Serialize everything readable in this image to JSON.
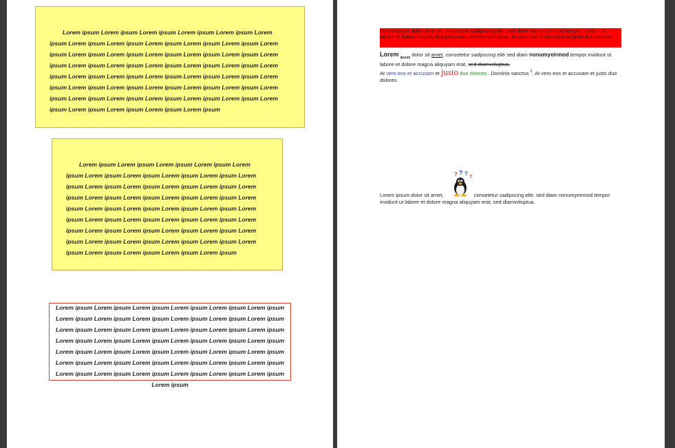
{
  "left_page": {
    "frame_1_text": "Lorem ipsum Lorem ipsum Lorem ipsum Lorem ipsum Lorem ipsum Lorem ipsum Lorem ipsum Lorem ipsum Lorem ipsum Lorem ipsum Lorem ipsum Lorem ipsum Lorem ipsum Lorem ipsum Lorem ipsum Lorem ipsum Lorem ipsum Lorem ipsum Lorem ipsum Lorem ipsum Lorem ipsum Lorem ipsum Lorem ipsum Lorem ipsum Lorem ipsum Lorem ipsum Lorem ipsum Lorem ipsum Lorem ipsum Lorem ipsum Lorem ipsum Lorem ipsum Lorem ipsum Lorem ipsum Lorem ipsum Lorem ipsum Lorem ipsum Lorem ipsum Lorem ipsum Lorem ipsum Lorem ipsum Lorem ipsum Lorem ipsum Lorem ipsum Lorem ipsum Lorem ipsum",
    "frame_2_text": "Lorem ipsum Lorem ipsum Lorem ipsum Lorem ipsum Lorem ipsum Lorem ipsum Lorem ipsum Lorem ipsum Lorem ipsum Lorem ipsum Lorem ipsum Lorem ipsum Lorem ipsum Lorem ipsum Lorem ipsum Lorem ipsum Lorem ipsum Lorem ipsum Lorem ipsum Lorem ipsum Lorem ipsum Lorem ipsum Lorem ipsum Lorem ipsum Lorem ipsum Lorem ipsum Lorem ipsum Lorem ipsum Lorem ipsum Lorem ipsum Lorem ipsum Lorem ipsum Lorem ipsum Lorem ipsum Lorem ipsum Lorem ipsum Lorem ipsum Lorem ipsum Lorem ipsum Lorem ipsum Lorem ipsum Lorem ipsum Lorem ipsum Lorem ipsum",
    "frame_3_text": "Lorem ipsum Lorem ipsum Lorem ipsum Lorem ipsum Lorem ipsum Lorem ipsum Lorem ipsum Lorem ipsum Lorem ipsum Lorem ipsum Lorem ipsum Lorem ipsum Lorem ipsum Lorem ipsum Lorem ipsum Lorem ipsum Lorem ipsum Lorem ipsum Lorem ipsum Lorem ipsum Lorem ipsum Lorem ipsum Lorem ipsum Lorem ipsum Lorem ipsum Lorem ipsum Lorem ipsum Lorem ipsum Lorem ipsum Lorem ipsum Lorem ipsum Lorem ipsum Lorem ipsum Lorem ipsum Lorem ipsum Lorem ipsum Lorem ipsum Lorem ipsum Lorem ipsum Lorem ipsum Lorem ipsum Lorem ipsum Lorem ipsum"
  },
  "right_page": {
    "red_block_text": "Lorem ipsum dolor sit amet, consetetur sadipscing elitr, sed diam nonumyeirmod tempor invidunt ut labore et dolore magna aliquyam erat, sed diamvoluptua. At vero eos et accusam et justo duo dolores",
    "formatted": {
      "lorem": "Lorem",
      "ipsum_sub": "ipsum",
      "dolor_sit": " dolor sit ",
      "amet": "amet",
      "comma": ", ",
      "consetetur": "consetetur sadipscing elitr",
      "sed_diam": " sed diam ",
      "nonumy": "nonumyeirmod",
      "tempor": " tempor invidunt ut labore et dolore magna aliquyam erat, ",
      "strike": "sed diamvoluptua.",
      "at": "At ",
      "vero": "vero eos et accusam",
      "et": " et ",
      "justo": "justo",
      "duo": " duo dolores",
      "dominis": " . Dominis sanctus ",
      "footnote": "5",
      "tail": ". At vero eos et accusam et justo duo dolores"
    },
    "image_para": {
      "before": "Lorem ipsum dolor sit amet, ",
      "after": " consetetur sadipscing elitr, sed diam nonumyeirmod tempor invidunt ut labore et dolore magna aliquyam erat, sed diamvoluptua."
    },
    "penguin_icon": "tux-penguin-question-marks"
  },
  "colors": {
    "frame_fill": "#ffff88",
    "frame_border": "#d9a84a",
    "red_frame_border": "#e0392b",
    "red_block": "#ff0000",
    "link_blue": "#2d3ad6",
    "justo_red": "#e02020",
    "green": "#1b9a1b",
    "background": "#3a3a3a"
  }
}
